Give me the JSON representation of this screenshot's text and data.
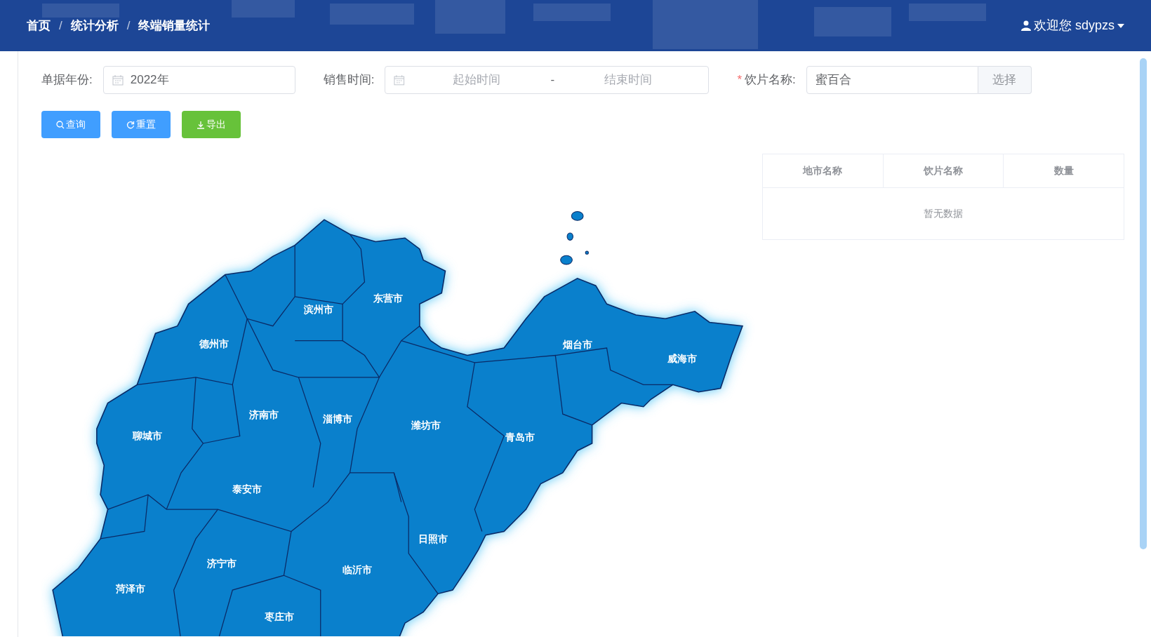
{
  "breadcrumb": [
    {
      "kind": "link",
      "text": "首页"
    },
    {
      "kind": "separator",
      "text": "/"
    },
    {
      "kind": "link",
      "text": "统计分析"
    },
    {
      "kind": "separator",
      "text": "/"
    },
    {
      "kind": "link",
      "text": "终端销量统计"
    }
  ],
  "user": {
    "greeting": "欢迎您 sdypzs"
  },
  "filters": [
    {
      "kind": "date",
      "label": "单据年份:",
      "value": "2022年"
    },
    {
      "kind": "range",
      "label": "销售时间:",
      "start_placeholder": "起始时间",
      "separator": "-",
      "end_placeholder": "结束时间"
    },
    {
      "kind": "picker",
      "required_mark": "*",
      "label": "饮片名称:",
      "value": "蜜百合",
      "button": "选择"
    }
  ],
  "buttons": [
    {
      "kind": "search",
      "label": "查询"
    },
    {
      "kind": "reset",
      "label": "重置"
    },
    {
      "kind": "export",
      "label": "导出"
    }
  ],
  "map": {
    "labels": [
      "滨州市",
      "东营市",
      "德州市",
      "烟台市",
      "威海市",
      "济南市",
      "淄博市",
      "潍坊市",
      "青岛市",
      "聊城市",
      "泰安市",
      "日照市",
      "济宁市",
      "临沂市",
      "菏泽市",
      "枣庄市"
    ]
  },
  "table": {
    "columns": [
      "地市名称",
      "饮片名称",
      "数量"
    ],
    "empty_text": "暂无数据"
  }
}
